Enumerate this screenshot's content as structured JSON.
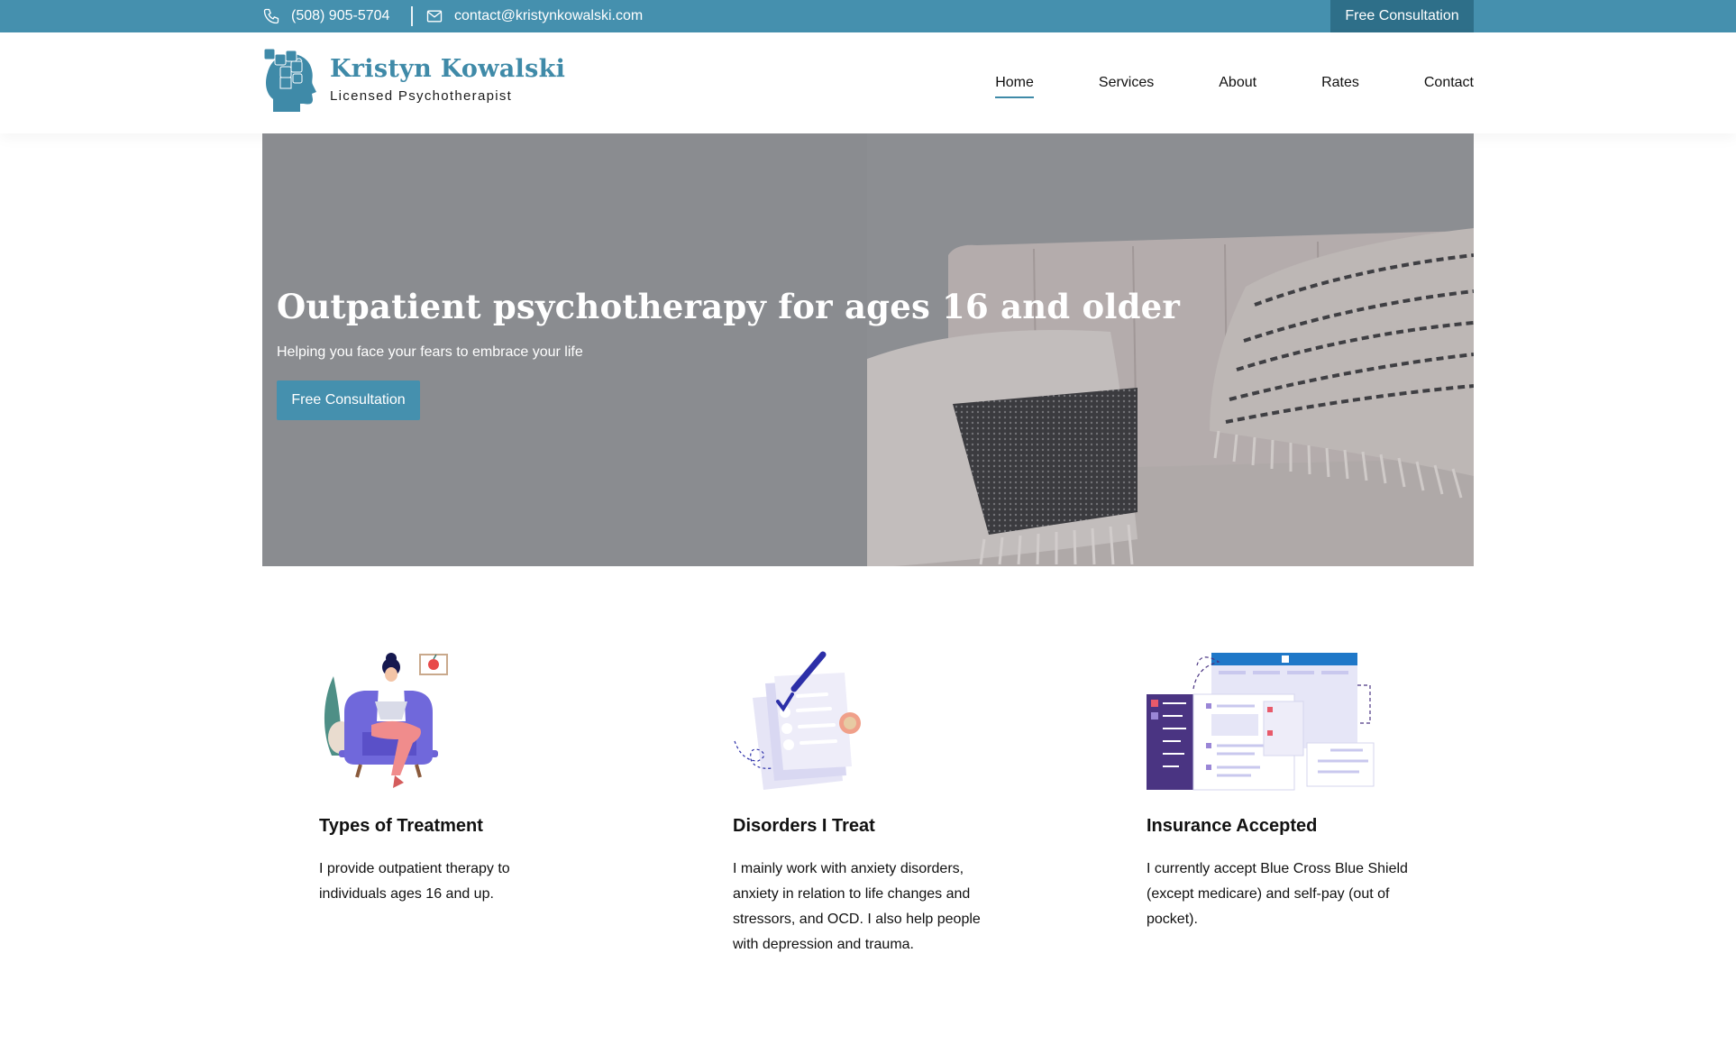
{
  "topbar": {
    "phone": "(508) 905-5704",
    "phone_icon": "phone-icon",
    "email": "contact@kristynkowalski.com",
    "email_icon": "mail-icon",
    "cta": "Free Consultation"
  },
  "header": {
    "logo_name": "Kristyn Kowalski",
    "logo_subtitle": "Licensed Psychotherapist",
    "logo_icon": "head-puzzle-icon",
    "nav": [
      {
        "label": "Home",
        "active": true
      },
      {
        "label": "Services",
        "active": false
      },
      {
        "label": "About",
        "active": false
      },
      {
        "label": "Rates",
        "active": false
      },
      {
        "label": "Contact",
        "active": false
      }
    ]
  },
  "hero": {
    "title": "Outpatient psychotherapy for ages 16 and older",
    "subtitle": "Helping you face your fears to embrace your life",
    "cta": "Free Consultation"
  },
  "features": [
    {
      "title": "Types of Treatment",
      "text": "I provide outpatient therapy to individuals ages 16 and up.",
      "illustration": "person-on-armchair-illustration"
    },
    {
      "title": "Disorders I Treat",
      "text": "I mainly work with anxiety disorders, anxiety in relation to life changes and stressors, and OCD. I also help people with depression and trauma.",
      "illustration": "checklist-document-illustration"
    },
    {
      "title": "Insurance Accepted",
      "text": "I currently accept Blue Cross Blue Shield (except medicare) and self-pay (out of pocket).",
      "illustration": "dashboard-windows-illustration"
    }
  ],
  "colors": {
    "brand": "#4590ae",
    "brand_dark": "#2e6f89",
    "hero_overlay": "#8a8c90"
  }
}
